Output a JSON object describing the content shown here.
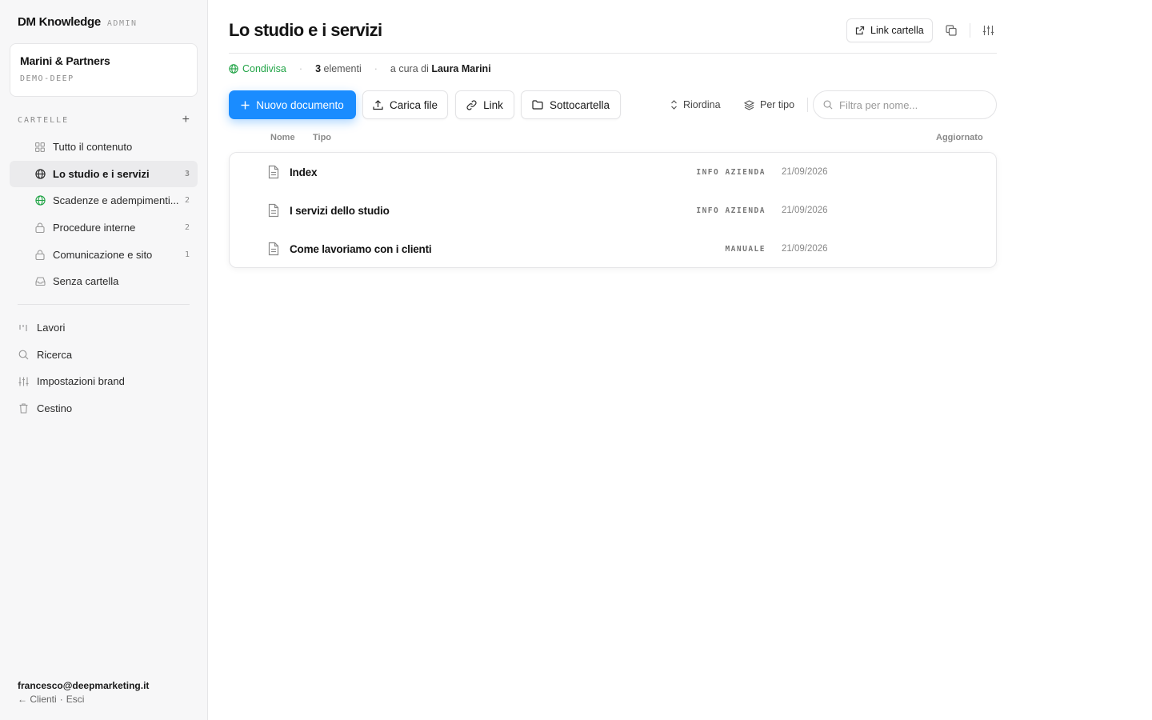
{
  "brand": {
    "name": "DM Knowledge",
    "tag": "ADMIN"
  },
  "workspace": {
    "name": "Marini & Partners",
    "code": "DEMO-DEEP"
  },
  "sidebar": {
    "section_label": "CARTELLE",
    "add_label": "+",
    "folders": [
      {
        "label": "Tutto il contenuto",
        "count": "",
        "icon": "grid-icon"
      },
      {
        "label": "Lo studio e i servizi",
        "count": "3",
        "icon": "globe-icon",
        "active": true
      },
      {
        "label": "Scadenze e adempimenti...",
        "count": "2",
        "icon": "globe-icon"
      },
      {
        "label": "Procedure interne",
        "count": "2",
        "icon": "lock-icon"
      },
      {
        "label": "Comunicazione e sito",
        "count": "1",
        "icon": "lock-icon"
      },
      {
        "label": "Senza cartella",
        "count": "",
        "icon": "inbox-icon"
      }
    ],
    "nav": [
      {
        "label": "Lavori",
        "icon": "bars-icon"
      },
      {
        "label": "Ricerca",
        "icon": "search-icon"
      },
      {
        "label": "Impostazioni brand",
        "icon": "sliders-icon"
      },
      {
        "label": "Cestino",
        "icon": "trash-icon"
      }
    ],
    "footer": {
      "email": "francesco@deepmarketing.it",
      "back": "← Clienti",
      "sep": "·",
      "logout": "Esci"
    }
  },
  "main": {
    "title": "Lo studio e i servizi",
    "link_folder_label": "Link cartella",
    "meta": {
      "shared": "Condivisa",
      "count_num": "3",
      "count_label": " elementi",
      "curated_prefix": "a cura di ",
      "curator": "Laura Marini"
    },
    "toolbar": {
      "new_doc": "Nuovo documento",
      "upload": "Carica file",
      "link": "Link",
      "subfolder": "Sottocartella",
      "reorder": "Riordina",
      "by_type": "Per tipo",
      "filter_placeholder": "Filtra per nome..."
    },
    "columns": {
      "name": "Nome",
      "type": "Tipo",
      "updated": "Aggiornato"
    },
    "documents": [
      {
        "name": "Index",
        "type": "INFO AZIENDA",
        "date": "21/09/2026"
      },
      {
        "name": "I servizi dello studio",
        "type": "INFO AZIENDA",
        "date": "21/09/2026"
      },
      {
        "name": "Come lavoriamo con i clienti",
        "type": "MANUALE",
        "date": "21/09/2026"
      }
    ]
  },
  "colors": {
    "accent": "#1a8cff",
    "shared_green": "#22a447"
  }
}
